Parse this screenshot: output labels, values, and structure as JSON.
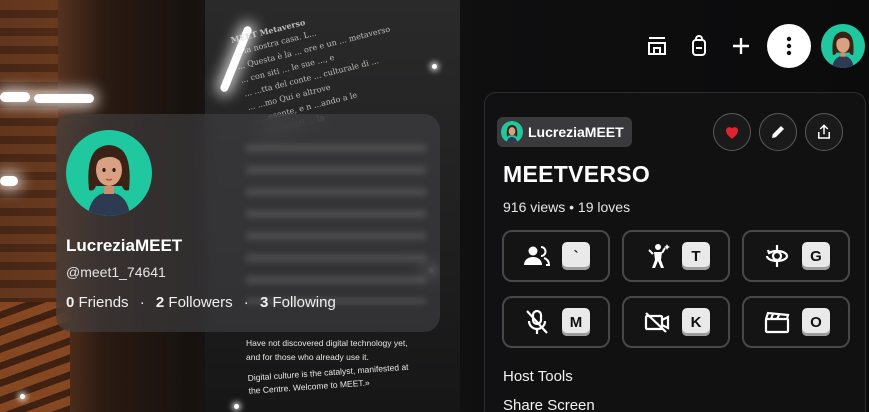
{
  "scene": {
    "wall_text_top": [
      "MEET Metaverso",
      "... la nostra casa. L...",
      "... Questa è la ... ore e un ... metaverso",
      "... con siti ... le sue ..., e",
      "... ...tta del conte ... culturale di ...",
      "... ...mo Qui e altrove",
      "... ...esente, e n ...ando a le",
      "... agli artisti ... la",
      "... ..."
    ],
    "wall_text_mid": "Have not discovered digital technology yet, and for those who already use it.",
    "wall_text_bottom": "Digital culture is the catalyst, manifested at the Centre. Welcome to MEET.»"
  },
  "profile": {
    "name": "LucreziaMEET",
    "handle": "@meet1_74641",
    "friends_count": "0",
    "friends_label": "Friends",
    "followers_count": "2",
    "followers_label": "Followers",
    "following_count": "3",
    "following_label": "Following",
    "separator": "·"
  },
  "topbar": {
    "icons": [
      "store-icon",
      "backpack-icon",
      "plus-icon",
      "more-icon",
      "user-avatar"
    ]
  },
  "space": {
    "author": "LucreziaMEET",
    "title": "MEETVERSO",
    "stats": "916 views • 19 loves",
    "controls": [
      {
        "icon": "people-icon",
        "key": "`"
      },
      {
        "icon": "emote-icon",
        "key": "T"
      },
      {
        "icon": "camera-rotate-icon",
        "key": "G"
      },
      {
        "icon": "mic-off-icon",
        "key": "M"
      },
      {
        "icon": "video-off-icon",
        "key": "K"
      },
      {
        "icon": "clapperboard-icon",
        "key": "O"
      }
    ],
    "links": [
      "Host Tools",
      "Share Screen"
    ]
  },
  "colors": {
    "accent_green": "#1fc89e",
    "heart_red": "#e0242f",
    "panel_bg": "#121213",
    "key_bg": "#e9e9ea"
  }
}
